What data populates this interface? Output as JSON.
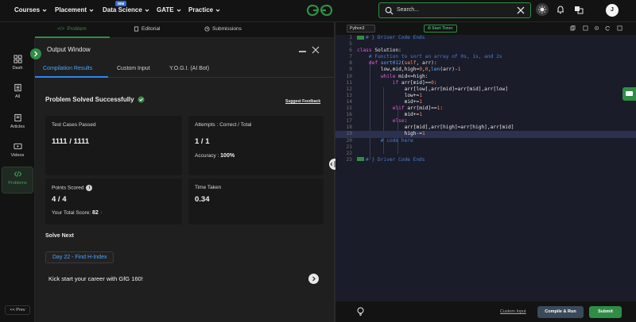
{
  "topnav": {
    "menus": [
      "Courses",
      "Placement",
      "Data Science",
      "GATE",
      "Practice"
    ],
    "ibm_badge": "IBM",
    "search_placeholder": "Search...",
    "avatar_initial": "J",
    "brand_color": "#2f8d46"
  },
  "problem_tabs": [
    "Problem",
    "Editorial",
    "Submissions"
  ],
  "sidebar": {
    "items": [
      "Dash",
      "All",
      "Articles",
      "Videos",
      "Problems"
    ],
    "prev_label": "<< Prev"
  },
  "output_window": {
    "title": "Output Window",
    "tabs": [
      "Compilation Results",
      "Custom Input",
      "Y.O.G.I. (AI Bot)"
    ],
    "status": "Problem Solved Successfully",
    "suggest_feedback": "Suggest Feedback",
    "cards": {
      "tests": {
        "label": "Test Cases Passed",
        "value": "1111 / 1111"
      },
      "attempts": {
        "label": "Attempts : Correct / Total",
        "value": "1 / 1",
        "accuracy_label": "Accuracy :",
        "accuracy_value": "100%"
      },
      "points": {
        "label": "Points Scored",
        "value": "4 / 4",
        "total_label": "Your Total Score:",
        "total_value": "82"
      },
      "time": {
        "label": "Time Taken",
        "value": "0.34"
      }
    },
    "solve_next_heading": "Solve Next",
    "next_problem": "Day 22 - Find H-Index",
    "kickstart": "Kick start your career with GfG 160!"
  },
  "editor": {
    "language": "Python3",
    "timer_label": "Start Timer",
    "code_lines": [
      {
        "n": "1",
        "text": "# } Driver Code Ends",
        "kind": "fold"
      },
      {
        "n": "5",
        "text": "",
        "kind": "plain"
      },
      {
        "n": "6",
        "text": "class Solution:",
        "kind": "plain"
      },
      {
        "n": "7",
        "text": "    # Function to sort an array of 0s, 1s, and 2s",
        "kind": "comment"
      },
      {
        "n": "8",
        "text": "    def sort012(self, arr):",
        "kind": "plain"
      },
      {
        "n": "9",
        "text": "        low,mid,high=0,0,len(arr)-1",
        "kind": "plain"
      },
      {
        "n": "10",
        "text": "        while mid<=high:",
        "kind": "plain"
      },
      {
        "n": "11",
        "text": "            if arr[mid]==0:",
        "kind": "plain"
      },
      {
        "n": "12",
        "text": "                arr[low],arr[mid]=arr[mid],arr[low]",
        "kind": "plain"
      },
      {
        "n": "13",
        "text": "                low+=1",
        "kind": "plain"
      },
      {
        "n": "14",
        "text": "                mid+=1",
        "kind": "plain"
      },
      {
        "n": "15",
        "text": "            elif arr[mid]==1:",
        "kind": "plain"
      },
      {
        "n": "16",
        "text": "                mid+=1",
        "kind": "plain"
      },
      {
        "n": "17",
        "text": "            else:",
        "kind": "plain"
      },
      {
        "n": "18",
        "text": "                arr[mid],arr[high]=arr[high],arr[mid]",
        "kind": "plain"
      },
      {
        "n": "19",
        "text": "                high-=1",
        "kind": "active"
      },
      {
        "n": "20",
        "text": "        # code here",
        "kind": "comment"
      },
      {
        "n": "21",
        "text": "",
        "kind": "plain"
      },
      {
        "n": "22",
        "text": "",
        "kind": "plain"
      },
      {
        "n": "23",
        "text": "# } Driver Code Ends",
        "kind": "fold"
      }
    ],
    "custom_input_label": "Custom Input",
    "compile_label": "Compile & Run",
    "submit_label": "Submit"
  }
}
